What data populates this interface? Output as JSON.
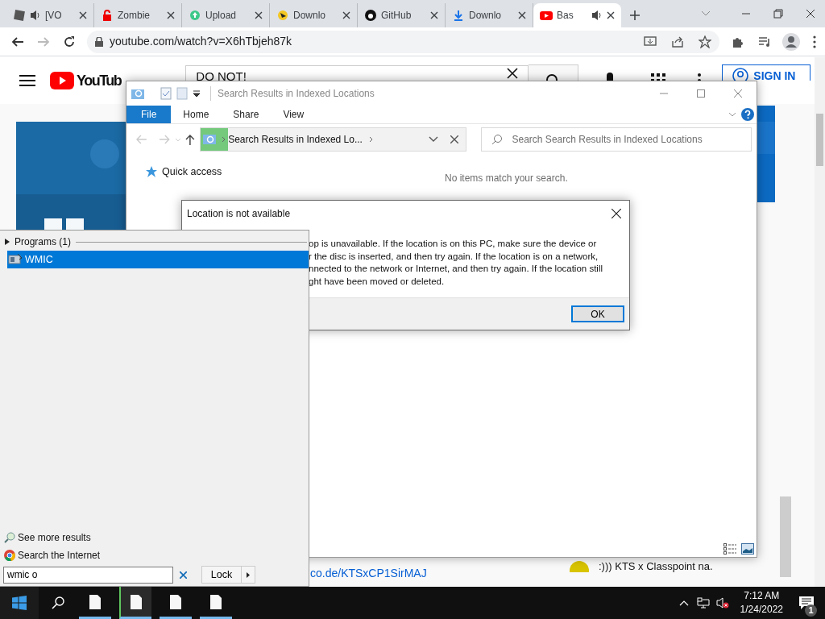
{
  "browser": {
    "tabs": [
      {
        "title": "[VO",
        "selected": false,
        "audio": true
      },
      {
        "title": "Zombie",
        "selected": false,
        "audio": false
      },
      {
        "title": "Upload",
        "selected": false,
        "audio": false
      },
      {
        "title": "Downlo",
        "selected": false,
        "audio": false
      },
      {
        "title": "GitHub",
        "selected": false,
        "audio": false
      },
      {
        "title": "Downlo",
        "selected": false,
        "audio": false
      },
      {
        "title": "Bas",
        "selected": true,
        "audio": true
      }
    ],
    "url": "youtube.com/watch?v=X6hTbjeh87k"
  },
  "youtube": {
    "logo": "YouTub",
    "search_value": "DO NOT!",
    "sign_in": "SIGN IN",
    "links": [
      "co.de/KTSxCP1SirMAJ"
    ],
    "comment": ":))) KTS x Classpoint na."
  },
  "explorer": {
    "title": "Search Results in Indexed Locations",
    "ribbon_tabs": [
      {
        "label": "File",
        "selected": true
      },
      {
        "label": "Home",
        "selected": false
      },
      {
        "label": "Share",
        "selected": false
      },
      {
        "label": "View",
        "selected": false
      }
    ],
    "breadcrumb": "Search Results in Indexed Lo...",
    "search": {
      "placeholder": "Search Search Results in Indexed Locations"
    },
    "nav_items": [
      "Quick access"
    ],
    "empty_message": "No items match your search."
  },
  "dialog": {
    "title": "Location is not available",
    "message_lines": [
      "op is unavailable. If the location is on this PC, make sure the device or",
      "r the disc is inserted, and then try again. If the location is on a network,",
      "nnected to the network or Internet, and then try again. If the location still",
      "ght have been moved or deleted."
    ],
    "button": "OK"
  },
  "start_menu": {
    "group": "Programs (1)",
    "results": [
      {
        "label": "WMIC",
        "selected": true
      }
    ],
    "links": [
      {
        "label": "See more results"
      },
      {
        "label": "Search the Internet"
      }
    ],
    "query": "wmic o",
    "power_button": "Lock"
  },
  "taskbar": {
    "apps": [
      {
        "active": false
      },
      {
        "active": true
      },
      {
        "active": false
      },
      {
        "active": false
      }
    ],
    "time": "7:12 AM",
    "date": "1/24/2022",
    "notifications": "1"
  }
}
